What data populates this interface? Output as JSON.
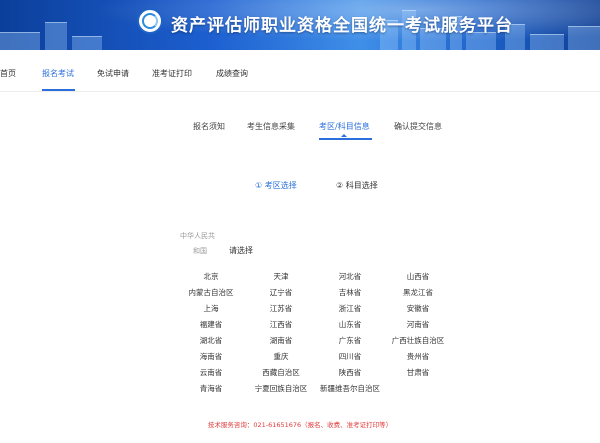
{
  "header": {
    "title": "资产评估师职业资格全国统一考试服务平台"
  },
  "nav": {
    "items": [
      {
        "label": "首页",
        "active": false
      },
      {
        "label": "报名考试",
        "active": true
      },
      {
        "label": "免试申请",
        "active": false
      },
      {
        "label": "准考证打印",
        "active": false
      },
      {
        "label": "成绩查询",
        "active": false
      }
    ]
  },
  "steps": {
    "items": [
      {
        "label": "报名须知",
        "active": false
      },
      {
        "label": "考生信息采集",
        "active": false
      },
      {
        "label": "考区/科目信息",
        "active": true
      },
      {
        "label": "确认提交信息",
        "active": false
      }
    ]
  },
  "substeps": {
    "items": [
      {
        "label": "① 考区选择",
        "active": true
      },
      {
        "label": "② 科目选择",
        "active": false
      }
    ]
  },
  "region": {
    "country_line1": "中华人民共",
    "country_line2": "和国",
    "prompt": "请选择",
    "provinces": [
      "北京",
      "天津",
      "河北省",
      "山西省",
      "内蒙古自治区",
      "辽宁省",
      "吉林省",
      "黑龙江省",
      "上海",
      "江苏省",
      "浙江省",
      "安徽省",
      "福建省",
      "江西省",
      "山东省",
      "河南省",
      "湖北省",
      "湖南省",
      "广东省",
      "广西壮族自治区",
      "海南省",
      "重庆",
      "四川省",
      "贵州省",
      "云南省",
      "西藏自治区",
      "陕西省",
      "甘肃省",
      "青海省",
      "宁夏回族自治区",
      "新疆维吾尔自治区"
    ]
  },
  "footer": {
    "text": "技术服务咨询：021-61651676（报名、收费、准考证打印等）"
  },
  "colors": {
    "accent": "#2a6fdb",
    "footer": "#e03c3c",
    "banner": "#1d5fd0"
  }
}
